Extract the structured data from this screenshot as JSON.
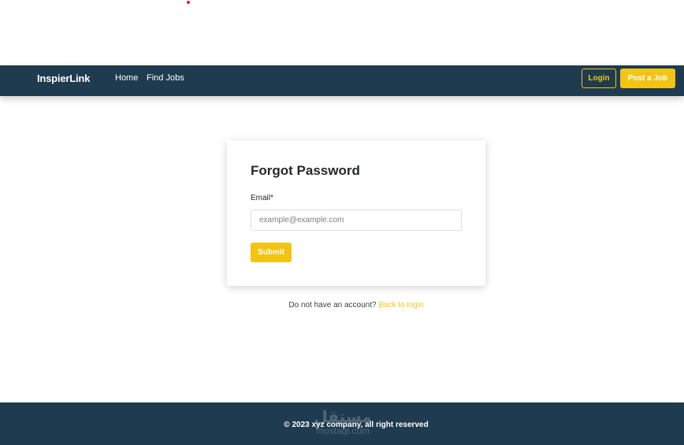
{
  "navbar": {
    "brand": "InspierLink",
    "links": [
      "Home",
      "Find Jobs"
    ],
    "login_label": "Login",
    "post_job_label": "Post a Job"
  },
  "form": {
    "title": "Forgot Password",
    "email_label": "Email*",
    "email_placeholder": "example@example.com",
    "email_value": "",
    "submit_label": "Submit"
  },
  "signup": {
    "prompt": "Do not have an account?",
    "link_label": "Back to login"
  },
  "footer": {
    "copyright": "© 2023 xyz company, all right reserved",
    "watermark_arabic": "مستقل",
    "watermark_latin": "mostaql.com"
  },
  "colors": {
    "navbar_bg": "#1f3b4f",
    "accent": "#f2c413",
    "page_bg": "#ffffff"
  }
}
